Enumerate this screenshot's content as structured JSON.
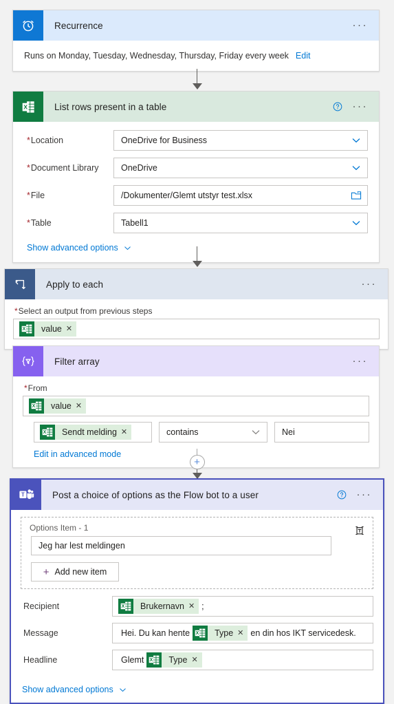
{
  "flow": {
    "steps": [
      {
        "id": "recurrence",
        "title": "Recurrence",
        "icon": "alarm-clock-icon",
        "header_color": "#dbeafc",
        "icon_color": "#0f78d4",
        "summary": "Runs on Monday, Tuesday, Wednesday, Thursday, Friday every week",
        "edit_label": "Edit",
        "more_label": "···"
      },
      {
        "id": "list-rows",
        "title": "List rows present in a table",
        "icon": "excel-icon",
        "header_color": "#d9e9de",
        "icon_color": "#107c41",
        "fields": [
          {
            "label": "Location",
            "required": true,
            "value": "OneDrive for Business",
            "control": "dropdown"
          },
          {
            "label": "Document Library",
            "required": true,
            "value": "OneDrive",
            "control": "dropdown"
          },
          {
            "label": "File",
            "required": true,
            "value": "/Dokumenter/Glemt utstyr test.xlsx",
            "control": "file-picker"
          },
          {
            "label": "Table",
            "required": true,
            "value": "Tabell1",
            "control": "dropdown"
          }
        ],
        "advanced_label": "Show advanced options"
      },
      {
        "id": "apply-to-each",
        "title": "Apply to each",
        "icon": "loop-icon",
        "header_color": "#dfe6f0",
        "icon_color": "#3b5a8a",
        "output_label": "Select an output from previous steps",
        "output_required": true,
        "output_token": {
          "label": "value",
          "icon": "excel-icon",
          "remove": "✕"
        }
      },
      {
        "id": "filter-array",
        "title": "Filter array",
        "icon": "filter-braces-icon",
        "header_color": "#e6e0fb",
        "icon_color": "#8661ef",
        "from_label": "From",
        "from_required": true,
        "from_token": {
          "label": "value",
          "icon": "excel-icon",
          "remove": "✕"
        },
        "condition": {
          "left_token": {
            "label": "Sendt melding",
            "icon": "excel-icon",
            "remove": "✕"
          },
          "operator": "contains",
          "value": "Nei"
        },
        "advanced_link": "Edit in advanced mode"
      },
      {
        "id": "post-choice",
        "title": "Post a choice of options as the Flow bot to a user",
        "icon": "teams-icon",
        "header_color": "#e4e6f7",
        "icon_color": "#4b53bc",
        "selected_border": "#4b53bc",
        "options": {
          "item_label": "Options Item - 1",
          "item_value": "Jeg har lest meldingen",
          "delete_icon": "trash-icon",
          "add_button": "Add new item"
        },
        "fields": [
          {
            "label": "Recipient",
            "parts": [
              {
                "type": "token",
                "label": "Brukernavn",
                "icon": "excel-icon",
                "remove": "✕"
              },
              {
                "type": "text",
                "value": ";"
              }
            ]
          },
          {
            "label": "Message",
            "parts": [
              {
                "type": "text",
                "value": "Hei. Du kan hente"
              },
              {
                "type": "token",
                "label": "Type",
                "icon": "excel-icon",
                "remove": "✕"
              },
              {
                "type": "text",
                "value": "en din hos IKT servicedesk."
              }
            ]
          },
          {
            "label": "Headline",
            "parts": [
              {
                "type": "text",
                "value": "Glemt"
              },
              {
                "type": "token",
                "label": "Type",
                "icon": "excel-icon",
                "remove": "✕"
              }
            ]
          }
        ],
        "advanced_label": "Show advanced options"
      }
    ],
    "connectors": {
      "add_step_label": "+"
    },
    "colors": {
      "link": "#0078d4",
      "required_asterisk": "#a4262c",
      "token_background": "#ddeedd",
      "excel_green": "#107c41",
      "canvas": "#f2f2f2"
    }
  }
}
